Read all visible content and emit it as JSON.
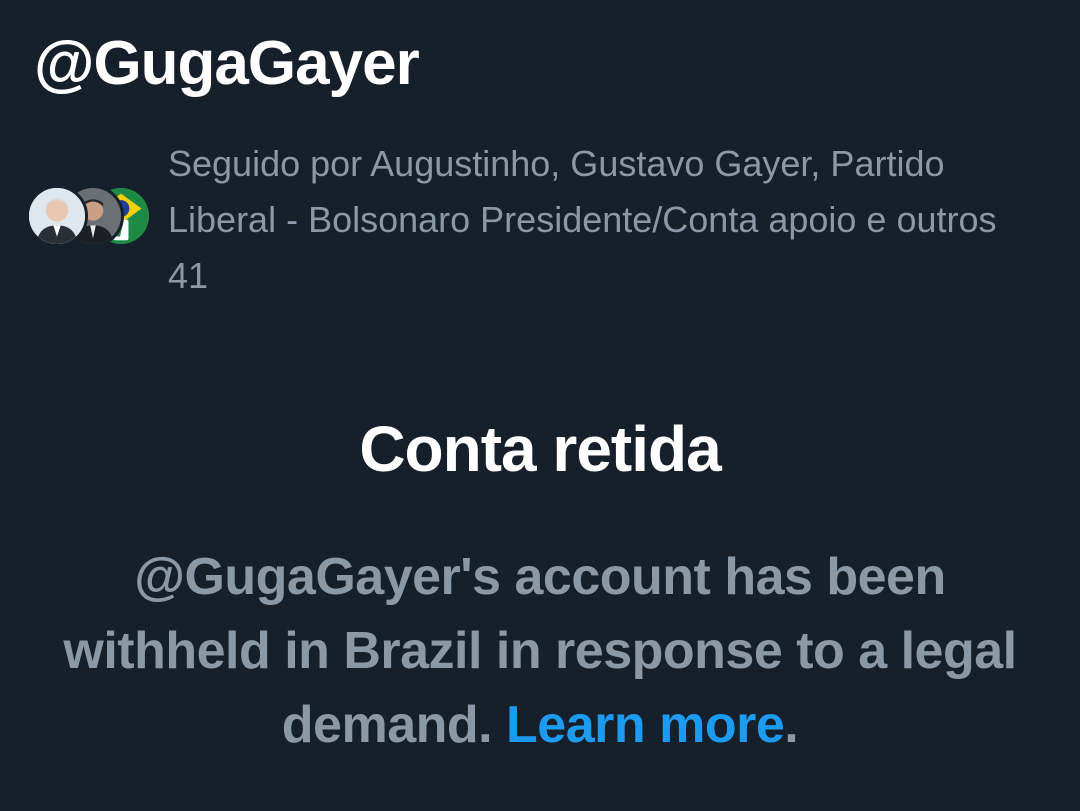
{
  "profile": {
    "handle": "@GugaGayer"
  },
  "followed_by": {
    "text": "Seguido por Augustinho, Gustavo Gayer, Partido Liberal - Bolsonaro Presidente/Conta apoio e outros 41",
    "avatars": [
      "avatar-augustinho",
      "avatar-gustavo-gayer",
      "avatar-partido-liberal"
    ]
  },
  "withheld": {
    "title": "Conta retida",
    "message": "@GugaGayer's account has been withheld in Brazil in response to a legal demand. ",
    "link_label": "Learn more",
    "suffix": "."
  },
  "colors": {
    "background": "#15202b",
    "primary_text": "#ffffff",
    "secondary_text": "#8b98a5",
    "link": "#1d9bf0"
  }
}
